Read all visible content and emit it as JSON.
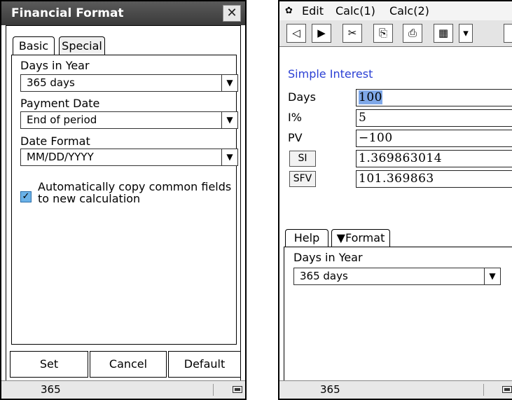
{
  "left": {
    "dialog_title": "Financial Format",
    "close_glyph": "✕",
    "tabs": [
      {
        "label": "Basic"
      },
      {
        "label": "Special"
      }
    ],
    "fields": [
      {
        "label": "Days in Year",
        "value": "365 days"
      },
      {
        "label": "Payment Date",
        "value": "End of period"
      },
      {
        "label": "Date Format",
        "value": "MM/DD/YYYY"
      }
    ],
    "checkbox": {
      "checked": true,
      "label": "Automatically copy common fields to new calculation"
    },
    "buttons": {
      "set": "Set",
      "cancel": "Cancel",
      "default": "Default"
    },
    "status": {
      "value": "365"
    }
  },
  "right": {
    "menu": {
      "gear_glyph": "✿",
      "edit": "Edit",
      "calc1": "Calc(1)",
      "calc2": "Calc(2)"
    },
    "toolbar": {
      "back": "◁",
      "play": "▶",
      "cut": "✂",
      "copy": "⎘",
      "paste": "⎙",
      "table": "▦",
      "more": "▾"
    },
    "section_title": "Simple Interest",
    "rows": [
      {
        "label": "Days",
        "value": "100",
        "highlight": true
      },
      {
        "label": "I%",
        "value": "5"
      },
      {
        "label": "PV",
        "value": "−100"
      },
      {
        "label": "SI",
        "value": "1.369863014",
        "button": true
      },
      {
        "label": "SFV",
        "value": "101.369863",
        "button": true
      }
    ],
    "tabs": [
      {
        "label": "Help"
      },
      {
        "label": "▼Format"
      }
    ],
    "format_label": "Days in Year",
    "format_value": "365 days",
    "status": {
      "value": "365"
    }
  },
  "icons": {
    "dropdown": "▼",
    "check": "✓"
  },
  "colors": {
    "title_bar": "#464646",
    "section_title": "#2a3fd4",
    "highlight": "#7fa8e8",
    "checkbox": "#6bb2e8"
  }
}
